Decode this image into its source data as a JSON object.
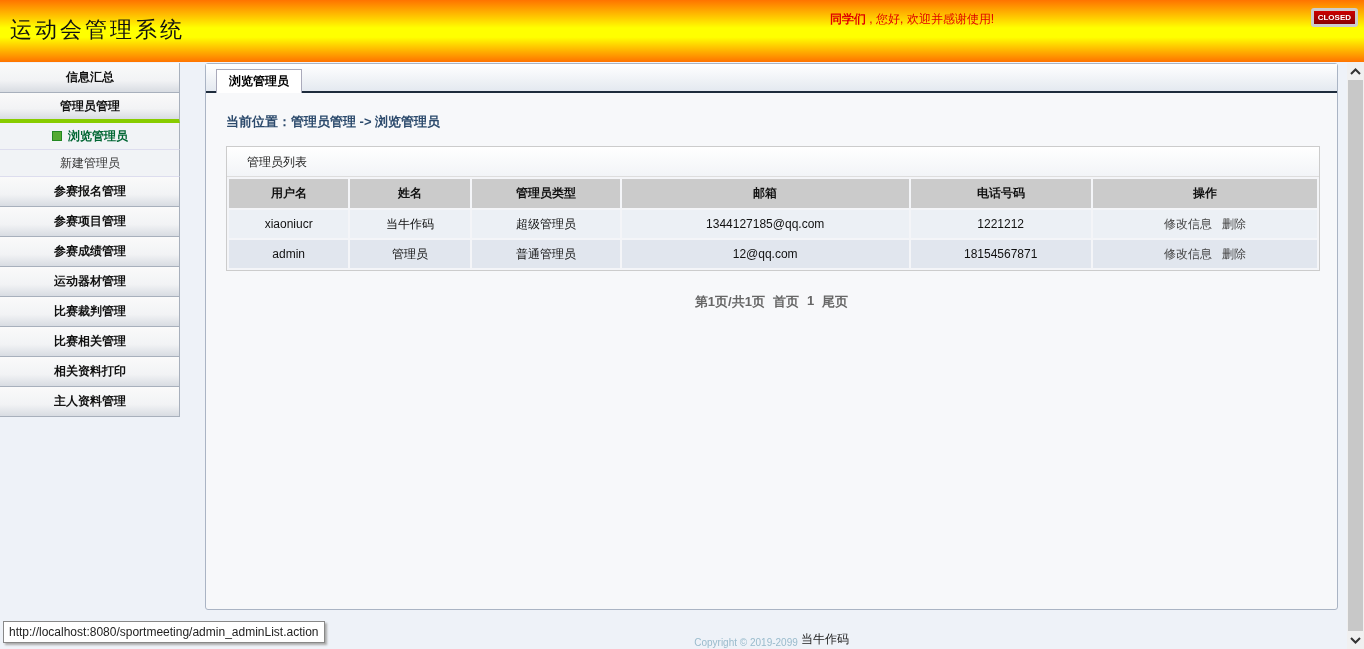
{
  "header": {
    "title": "运动会管理系统",
    "greeting": "**同学们** , 您好, 欢迎并感谢使用!",
    "close_button": "CLOSED"
  },
  "sidebar": {
    "items": [
      {
        "label": "信息汇总",
        "expanded": false
      },
      {
        "label": "管理员管理",
        "expanded": true,
        "children": [
          {
            "label": "浏览管理员",
            "selected": true
          },
          {
            "label": "新建管理员",
            "selected": false
          }
        ]
      },
      {
        "label": "参赛报名管理",
        "expanded": false
      },
      {
        "label": "参赛项目管理",
        "expanded": false
      },
      {
        "label": "参赛成绩管理",
        "expanded": false
      },
      {
        "label": "运动器材管理",
        "expanded": false
      },
      {
        "label": "比赛裁判管理",
        "expanded": false
      },
      {
        "label": "比赛相关管理",
        "expanded": false
      },
      {
        "label": "相关资料打印",
        "expanded": false
      },
      {
        "label": "主人资料管理",
        "expanded": false
      }
    ]
  },
  "tabs": [
    {
      "label": "浏览管理员",
      "selected": true
    }
  ],
  "breadcrumb": "当前位置：管理员管理 -> 浏览管理员",
  "table": {
    "title": "管理员列表",
    "columns": [
      "用户名",
      "姓名",
      "管理员类型",
      "邮箱",
      "电话号码",
      "操作"
    ],
    "rows": [
      {
        "cells": [
          "xiaoniucr",
          "当牛作码",
          "超级管理员",
          "1344127185@qq.com",
          "1221212"
        ],
        "actions": [
          "修改信息",
          "删除"
        ]
      },
      {
        "cells": [
          "admin",
          "管理员",
          "普通管理员",
          "12@qq.com",
          "18154567871"
        ],
        "actions": [
          "修改信息",
          "删除"
        ]
      }
    ]
  },
  "pagination": {
    "summary": "第1页/共1页",
    "first": "首页",
    "pages": [
      "1"
    ],
    "last": "尾页"
  },
  "footer": {
    "copyright": "Copyright © 2019-2099",
    "author": "当牛作码"
  },
  "status_url": "http://localhost:8080/sportmeeting/admin_adminList.action"
}
